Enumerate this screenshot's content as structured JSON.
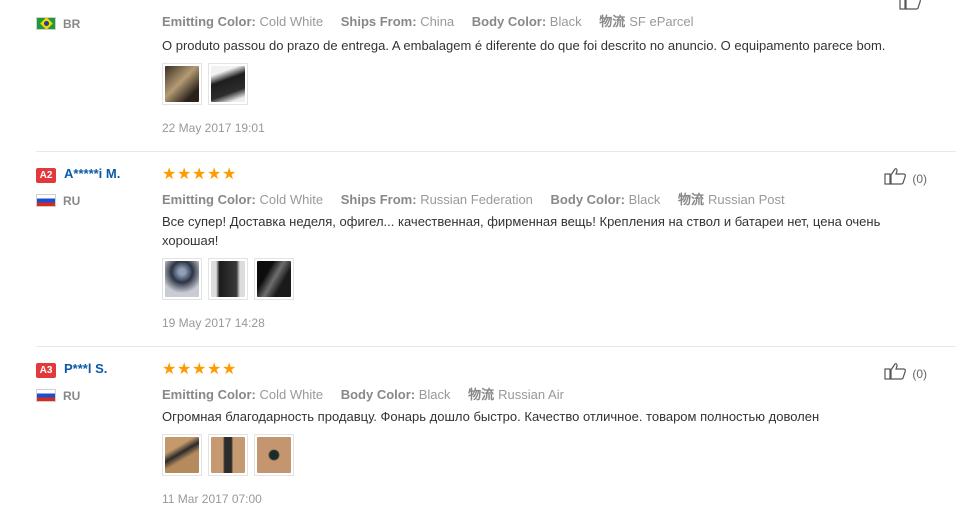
{
  "reviews": [
    {
      "level": "",
      "user": "",
      "country": "BR",
      "flag": "brazil-flag-icon",
      "stars": 0,
      "attributes": [
        {
          "key": "Emitting Color:",
          "value": "Cold White"
        },
        {
          "key": "Ships From:",
          "value": "China"
        },
        {
          "key": "Body Color:",
          "value": "Black"
        },
        {
          "key": "物流",
          "value": "SF eParcel"
        }
      ],
      "text": "O produto passou do prazo de entrega. A embalagem é diferente do que foi descrito no anuncio. O equipamento parece bom.",
      "date": "22 May 2017 19:01",
      "helpful": ""
    },
    {
      "level": "A2",
      "user": "A*****i M.",
      "country": "RU",
      "flag": "russia-flag-icon",
      "stars": 5,
      "attributes": [
        {
          "key": "Emitting Color:",
          "value": "Cold White"
        },
        {
          "key": "Ships From:",
          "value": "Russian Federation"
        },
        {
          "key": "Body Color:",
          "value": "Black"
        },
        {
          "key": "物流",
          "value": "Russian Post"
        }
      ],
      "text": "Все супер! Доставка неделя, офигел... качественная, фирменная вещь! Крепления на ствол и батареи нет, цена очень хорошая!",
      "date": "19 May 2017 14:28",
      "helpful": "(0)"
    },
    {
      "level": "A3",
      "user": "P***l S.",
      "country": "RU",
      "flag": "russia-flag-icon",
      "stars": 5,
      "attributes": [
        {
          "key": "Emitting Color:",
          "value": "Cold White"
        },
        {
          "key": "Body Color:",
          "value": "Black"
        },
        {
          "key": "物流",
          "value": "Russian Air"
        }
      ],
      "text": "Огромная благодарность продавцу. Фонарь дошло быстро. Качество отличное. товаром полностью доволен",
      "date": "11 Mar 2017 07:00",
      "helpful": "(0)"
    }
  ],
  "colors": {
    "accent_star": "#ff9a00",
    "badge": "#e4393c",
    "username": "#0b5aa8"
  }
}
